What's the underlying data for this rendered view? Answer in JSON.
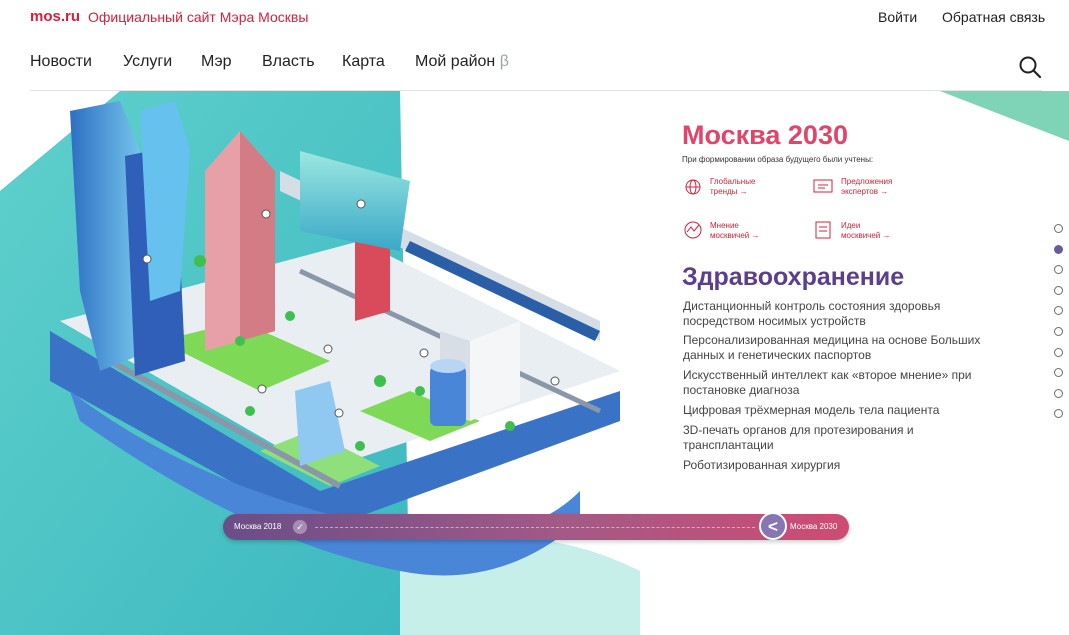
{
  "header": {
    "logo": "mos.ru",
    "site_title": "Официальный сайт Мэра Москвы",
    "login": "Войти",
    "feedback": "Обратная связь"
  },
  "nav": {
    "items": [
      "Новости",
      "Услуги",
      "Мэр",
      "Власть",
      "Карта"
    ],
    "district": "Мой район",
    "beta": "β"
  },
  "hero": {
    "title": "Москва 2030",
    "subtitle": "При формировании образа будущего были учтены:",
    "factors": [
      {
        "line1": "Глобальные",
        "line2": "тренды →",
        "icon": "globe-icon"
      },
      {
        "line1": "Предложения",
        "line2": "экспертов →",
        "icon": "expert-icon"
      },
      {
        "line1": "Мнение",
        "line2": "москвичей →",
        "icon": "opinion-icon"
      },
      {
        "line1": "Идеи",
        "line2": "москвичей →",
        "icon": "ideas-icon"
      }
    ]
  },
  "section": {
    "title": "Здравоохранение",
    "items": [
      "Дистанционный контроль состояния здоровья посредством носимых устройств",
      "Персонализированная медицина на основе Больших данных и генетических паспортов",
      "Искусственный интеллект как «второе мнение» при постановке диагноза",
      "Цифровая трёхмерная модель тела пациента",
      "3D-печать органов для протезирования и трансплантации",
      "Роботизированная хирургия"
    ]
  },
  "pagination": {
    "count": 10,
    "active_index": 1
  },
  "timeline": {
    "start": "Москва 2018",
    "end": "Москва 2030",
    "handle_icon": "chevron-left-icon"
  },
  "colors": {
    "brand": "#d4203c",
    "accent": "#e0456a",
    "section": "#5b3f8c",
    "teal": "#4bc4c4"
  }
}
